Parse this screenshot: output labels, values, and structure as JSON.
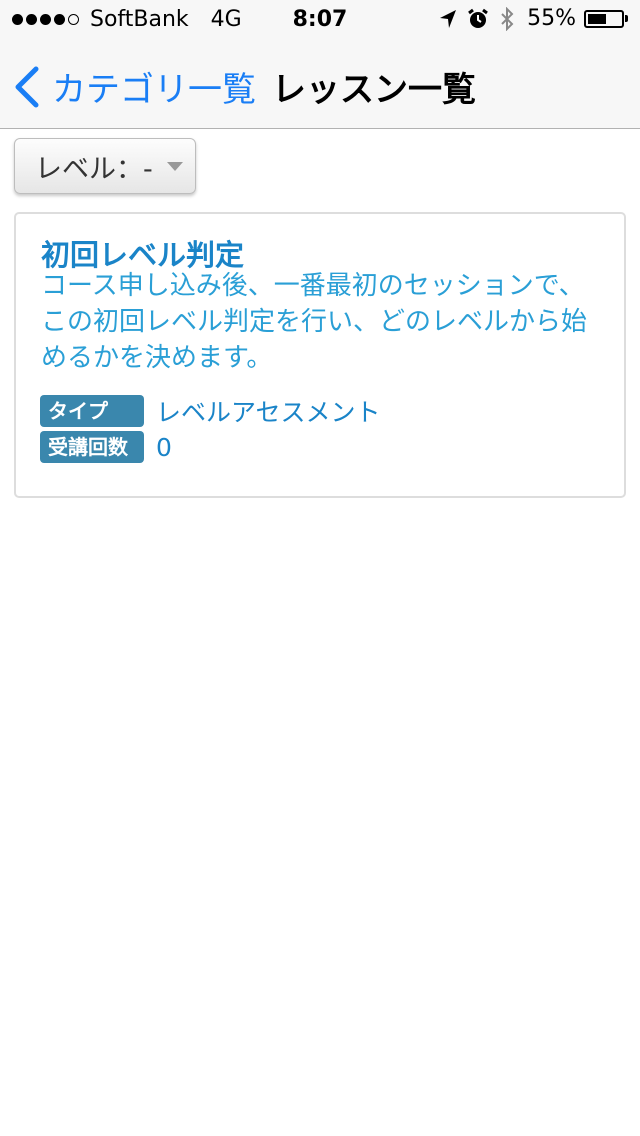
{
  "status_bar": {
    "carrier": "SoftBank",
    "network": "4G",
    "time": "8:07",
    "battery_percent": "55%",
    "battery_level": 0.55,
    "signal_bars_filled": 4,
    "signal_bars_total": 5
  },
  "nav": {
    "back_label": "カテゴリ一覧",
    "title": "レッスン一覧",
    "accent_color": "#1a7ef5"
  },
  "filter": {
    "level_label": "レベル：-"
  },
  "lesson": {
    "title": "初回レベル判定",
    "description": "コース申し込み後、一番最初のセッションで、この初回レベル判定を行い、どのレベルから始めるかを決めます。",
    "type_label": "タイプ",
    "type_value": "レベルアセスメント",
    "count_label": "受講回数",
    "count_value": "0",
    "label_color": "#3a87ad",
    "text_color": "#1a84c8"
  },
  "icons": [
    "location-arrow-icon",
    "alarm-clock-icon",
    "bluetooth-icon",
    "battery-icon",
    "chevron-left-icon",
    "caret-down-icon"
  ]
}
